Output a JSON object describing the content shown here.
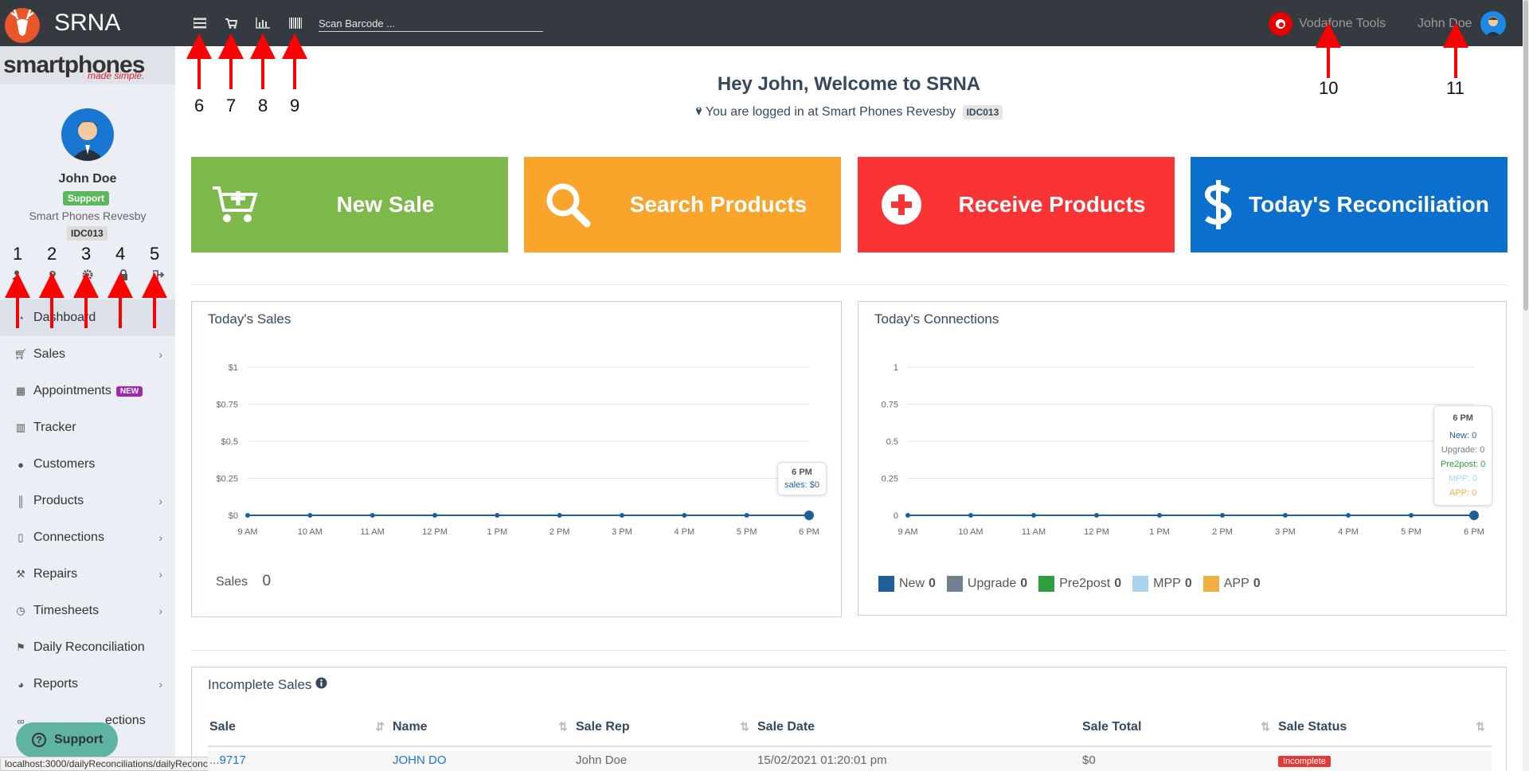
{
  "app": {
    "title": "SRNA"
  },
  "topbar": {
    "scan_placeholder": "Scan Barcode ...",
    "vodafone_label": "Vodafone Tools",
    "user_name": "John Doe",
    "icons": [
      "list-icon",
      "cart-icon",
      "bar-chart-icon",
      "barcode-icon"
    ]
  },
  "sidebar": {
    "logo_text": "smartphones",
    "logo_tagline": "made simple.",
    "profile": {
      "name": "John Doe",
      "role": "Support",
      "store": "Smart Phones Revesby",
      "code": "IDC013"
    },
    "profile_icons": [
      "user-icon",
      "map-marker-icon",
      "gear-icon",
      "lock-icon",
      "sign-out-icon"
    ],
    "items": [
      {
        "label": "Dashboard",
        "icon": "dashboard-icon",
        "chevron": false
      },
      {
        "label": "Sales",
        "icon": "cart-icon",
        "chevron": true
      },
      {
        "label": "Appointments",
        "icon": "calendar-icon",
        "badge": "NEW",
        "chevron": false
      },
      {
        "label": "Tracker",
        "icon": "bar-chart-icon",
        "chevron": false
      },
      {
        "label": "Customers",
        "icon": "users-icon",
        "chevron": false
      },
      {
        "label": "Products",
        "icon": "barcode-icon",
        "chevron": true
      },
      {
        "label": "Connections",
        "icon": "mobile-icon",
        "chevron": true
      },
      {
        "label": "Repairs",
        "icon": "wrench-icon",
        "chevron": true
      },
      {
        "label": "Timesheets",
        "icon": "clock-icon",
        "chevron": true
      },
      {
        "label": "Daily Reconciliation",
        "icon": "flag-icon",
        "chevron": false
      },
      {
        "label": "Reports",
        "icon": "pie-chart-icon",
        "chevron": true
      },
      {
        "label": "ections",
        "icon": "link-icon",
        "chevron": false
      }
    ],
    "support_button": "Support"
  },
  "statusbar": {
    "url": "localhost:3000/dailyReconciliations/dailyReconciliation"
  },
  "main": {
    "welcome": "Hey John, Welcome to SRNA",
    "logged_in_text": "You are logged in at Smart Phones Revesby",
    "store_code": "IDC013",
    "tiles": [
      {
        "label": "New Sale",
        "color": "#7cb84a",
        "icon": "cart-plus-icon"
      },
      {
        "label": "Search Products",
        "color": "#f9a42a",
        "icon": "search-icon"
      },
      {
        "label": "Receive Products",
        "color": "#fa3434",
        "icon": "plus-circle-icon"
      },
      {
        "label": "Today's Reconciliation",
        "color": "#0b6fce",
        "icon": "dollar-icon"
      }
    ]
  },
  "chart_data": [
    {
      "type": "line",
      "title": "Today's Sales",
      "categories": [
        "9 AM",
        "10 AM",
        "11 AM",
        "12 PM",
        "1 PM",
        "2 PM",
        "3 PM",
        "4 PM",
        "5 PM",
        "6 PM"
      ],
      "series": [
        {
          "name": "sales",
          "values": [
            0,
            0,
            0,
            0,
            0,
            0,
            0,
            0,
            0,
            0
          ]
        }
      ],
      "yticks": [
        "$0",
        "$0.25",
        "$0.5",
        "$0.75",
        "$1"
      ],
      "ylim": [
        0,
        1
      ],
      "tooltip": {
        "title": "6 PM",
        "lines": [
          "sales: $0"
        ]
      },
      "summary": {
        "label": "Sales",
        "value": "0"
      },
      "color": "#1f5f99"
    },
    {
      "type": "line",
      "title": "Today's Connections",
      "categories": [
        "9 AM",
        "10 AM",
        "11 AM",
        "12 PM",
        "1 PM",
        "2 PM",
        "3 PM",
        "4 PM",
        "5 PM",
        "6 PM"
      ],
      "series": [
        {
          "name": "New",
          "values": [
            0,
            0,
            0,
            0,
            0,
            0,
            0,
            0,
            0,
            0
          ],
          "color": "#1f5f99"
        },
        {
          "name": "Upgrade",
          "values": [
            0,
            0,
            0,
            0,
            0,
            0,
            0,
            0,
            0,
            0
          ],
          "color": "#708090"
        },
        {
          "name": "Pre2post",
          "values": [
            0,
            0,
            0,
            0,
            0,
            0,
            0,
            0,
            0,
            0
          ],
          "color": "#2e9e3e"
        },
        {
          "name": "MPP",
          "values": [
            0,
            0,
            0,
            0,
            0,
            0,
            0,
            0,
            0,
            0
          ],
          "color": "#a8d4f0"
        },
        {
          "name": "APP",
          "values": [
            0,
            0,
            0,
            0,
            0,
            0,
            0,
            0,
            0,
            0
          ],
          "color": "#f0b040"
        }
      ],
      "yticks": [
        "0",
        "0.25",
        "0.5",
        "0.75",
        "1"
      ],
      "ylim": [
        0,
        1
      ],
      "tooltip": {
        "title": "6 PM",
        "lines": [
          "New: 0",
          "Upgrade: 0",
          "Pre2post: 0",
          "MPP: 0",
          "APP: 0"
        ]
      },
      "legend_totals": [
        "0",
        "0",
        "0",
        "0",
        "0"
      ]
    }
  ],
  "incomplete_sales": {
    "title": "Incomplete Sales",
    "columns": [
      "Sale",
      "Name",
      "Sale Rep",
      "Sale Date",
      "Sale Total",
      "Sale Status"
    ],
    "rows": [
      {
        "sale": "...9717",
        "name": "JOHN DO",
        "rep": "John Doe",
        "date": "15/02/2021 01:20:01 pm",
        "total": "$0",
        "status": "Incomplete"
      }
    ]
  },
  "annotations": [
    "1",
    "2",
    "3",
    "4",
    "5",
    "6",
    "7",
    "8",
    "9",
    "10",
    "11"
  ]
}
